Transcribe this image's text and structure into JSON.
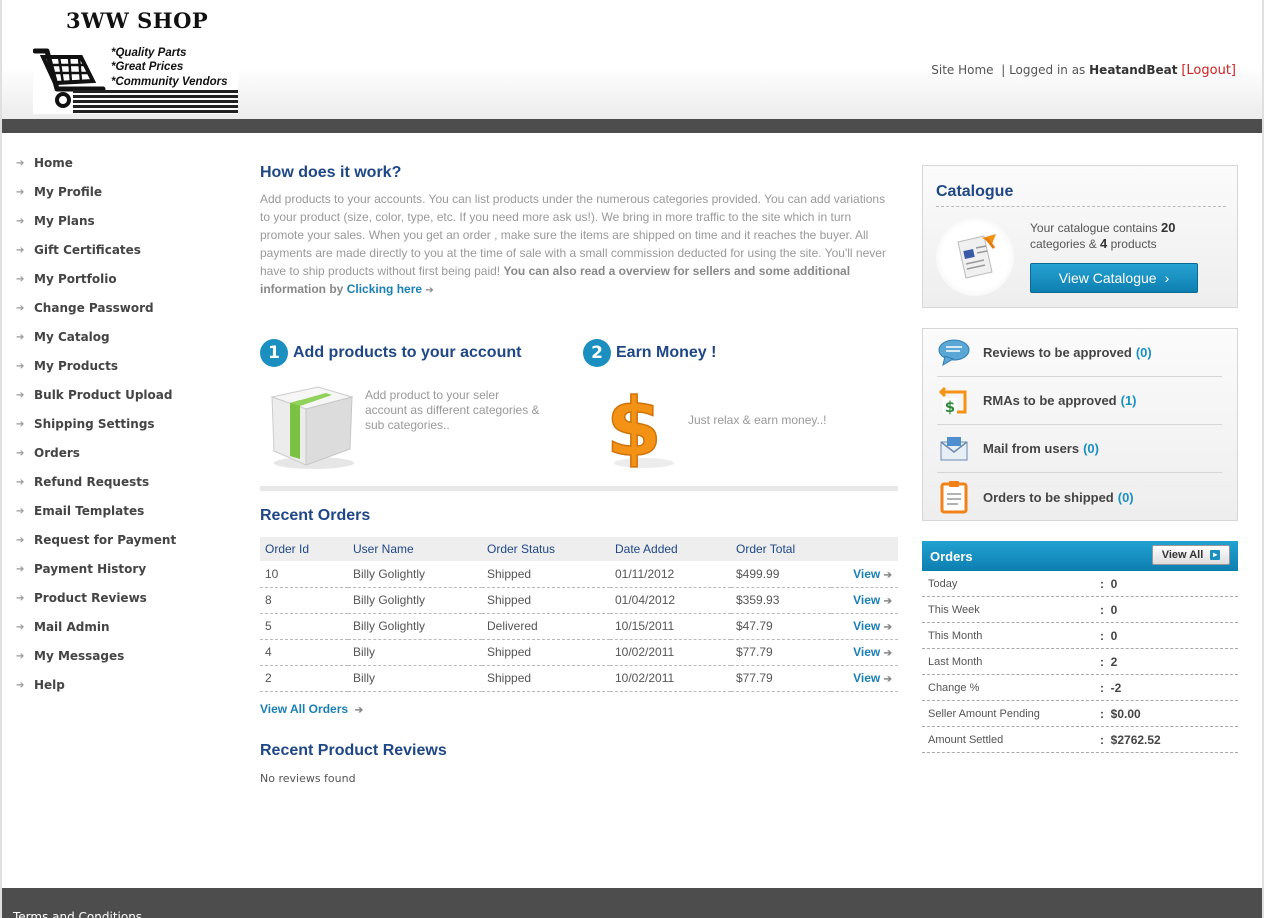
{
  "header": {
    "logo": {
      "title": "3WW SHOP",
      "taglines": [
        "*Quality Parts",
        "*Great Prices",
        "*Community Vendors"
      ]
    },
    "nav": {
      "site_home": "Site Home",
      "separator": "|",
      "logged_in_prefix": "Logged in as",
      "username": "HeatandBeat",
      "logout": "[Logout]"
    }
  },
  "sidebar": {
    "items": [
      {
        "label": "Home"
      },
      {
        "label": "My Profile"
      },
      {
        "label": "My Plans"
      },
      {
        "label": "Gift Certificates"
      },
      {
        "label": "My Portfolio"
      },
      {
        "label": "Change Password"
      },
      {
        "label": "My Catalog"
      },
      {
        "label": "My Products"
      },
      {
        "label": "Bulk Product Upload"
      },
      {
        "label": "Shipping Settings"
      },
      {
        "label": "Orders"
      },
      {
        "label": "Refund Requests"
      },
      {
        "label": "Email Templates"
      },
      {
        "label": "Request for Payment"
      },
      {
        "label": "Payment History"
      },
      {
        "label": "Product Reviews"
      },
      {
        "label": "Mail Admin"
      },
      {
        "label": "My Messages"
      },
      {
        "label": "Help"
      }
    ]
  },
  "main": {
    "how_title": "How does it work?",
    "how_text": "Add products to your accounts. You can list products under the numerous categories provided. You can add variations to your product (size, color, type, etc. If you need more ask us!). We bring in more traffic to the site which in turn promote your sales. When you get an order , make sure the items are shipped on time and it reaches the buyer. All payments are made directly to you at the time of sale with a small commission deducted for using the site. You'll never have to ship products without first being paid!",
    "how_bold": "You can also read a overview for sellers and some additional information by",
    "how_link": "Clicking here",
    "steps": [
      {
        "num": "1",
        "title": "Add products to your account",
        "text": "Add product to your seler account as different categories & sub categories.."
      },
      {
        "num": "2",
        "title": "Earn Money !",
        "text": "Just relax & earn money..!"
      }
    ],
    "recent_orders": {
      "title": "Recent Orders",
      "columns": [
        "Order Id",
        "User Name",
        "Order Status",
        "Date Added",
        "Order Total"
      ],
      "rows": [
        {
          "id": "10",
          "user": "Billy Golightly",
          "status": "Shipped",
          "date": "01/11/2012",
          "total": "$499.99",
          "action": "View"
        },
        {
          "id": "8",
          "user": "Billy Golightly",
          "status": "Shipped",
          "date": "01/04/2012",
          "total": "$359.93",
          "action": "View"
        },
        {
          "id": "5",
          "user": "Billy Golightly",
          "status": "Delivered",
          "date": "10/15/2011",
          "total": "$47.79",
          "action": "View"
        },
        {
          "id": "4",
          "user": "Billy",
          "status": "Shipped",
          "date": "10/02/2011",
          "total": "$77.79",
          "action": "View"
        },
        {
          "id": "2",
          "user": "Billy",
          "status": "Shipped",
          "date": "10/02/2011",
          "total": "$77.79",
          "action": "View"
        }
      ],
      "view_all": "View All Orders"
    },
    "recent_reviews": {
      "title": "Recent Product Reviews",
      "empty": "No reviews found"
    }
  },
  "catalogue": {
    "title": "Catalogue",
    "desc_prefix": "Your catalogue contains",
    "categories_count": "20",
    "desc_mid": "categories &",
    "products_count": "4",
    "desc_suffix": "products",
    "button": "View Catalogue"
  },
  "pending": [
    {
      "label": "Reviews to be approved",
      "count": "(0)",
      "icon": "speech-bubble-icon"
    },
    {
      "label": "RMAs to be approved",
      "count": "(1)",
      "icon": "dollar-return-icon"
    },
    {
      "label": "Mail from users",
      "count": "(0)",
      "icon": "envelope-icon"
    },
    {
      "label": "Orders to be shipped",
      "count": "(0)",
      "icon": "clipboard-icon"
    }
  ],
  "orders_stats": {
    "title": "Orders",
    "view_all": "View All",
    "rows": [
      {
        "label": "Today",
        "value": "0"
      },
      {
        "label": "This Week",
        "value": "0"
      },
      {
        "label": "This Month",
        "value": "0"
      },
      {
        "label": "Last Month",
        "value": "2"
      },
      {
        "label": "Change %",
        "value": "-2"
      },
      {
        "label": "Seller Amount Pending",
        "value": "$0.00"
      },
      {
        "label": "Amount Settled",
        "value": "$2762.52"
      }
    ]
  },
  "footer": {
    "link": "Terms and Conditions"
  },
  "colors": {
    "accent": "#1a8fc0",
    "heading": "#1f4786",
    "link": "#1a7fb5",
    "bar": "#4d4d4d",
    "logout": "#cc2222"
  }
}
